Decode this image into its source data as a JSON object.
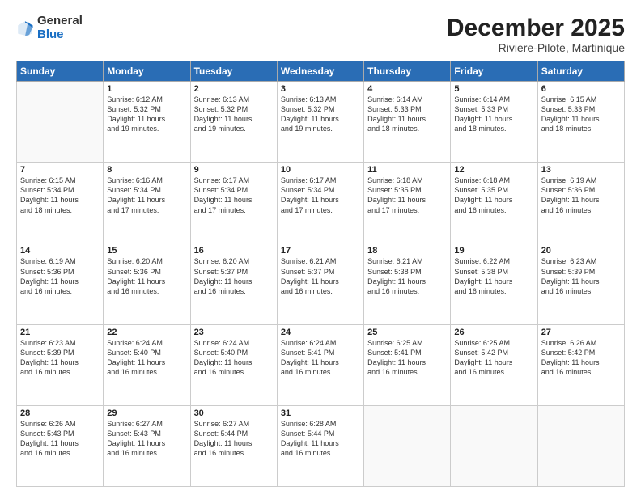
{
  "logo": {
    "general": "General",
    "blue": "Blue"
  },
  "title": "December 2025",
  "subtitle": "Riviere-Pilote, Martinique",
  "days_header": [
    "Sunday",
    "Monday",
    "Tuesday",
    "Wednesday",
    "Thursday",
    "Friday",
    "Saturday"
  ],
  "weeks": [
    [
      {
        "day": "",
        "info": ""
      },
      {
        "day": "1",
        "info": "Sunrise: 6:12 AM\nSunset: 5:32 PM\nDaylight: 11 hours\nand 19 minutes."
      },
      {
        "day": "2",
        "info": "Sunrise: 6:13 AM\nSunset: 5:32 PM\nDaylight: 11 hours\nand 19 minutes."
      },
      {
        "day": "3",
        "info": "Sunrise: 6:13 AM\nSunset: 5:32 PM\nDaylight: 11 hours\nand 19 minutes."
      },
      {
        "day": "4",
        "info": "Sunrise: 6:14 AM\nSunset: 5:33 PM\nDaylight: 11 hours\nand 18 minutes."
      },
      {
        "day": "5",
        "info": "Sunrise: 6:14 AM\nSunset: 5:33 PM\nDaylight: 11 hours\nand 18 minutes."
      },
      {
        "day": "6",
        "info": "Sunrise: 6:15 AM\nSunset: 5:33 PM\nDaylight: 11 hours\nand 18 minutes."
      }
    ],
    [
      {
        "day": "7",
        "info": "Sunrise: 6:15 AM\nSunset: 5:34 PM\nDaylight: 11 hours\nand 18 minutes."
      },
      {
        "day": "8",
        "info": "Sunrise: 6:16 AM\nSunset: 5:34 PM\nDaylight: 11 hours\nand 17 minutes."
      },
      {
        "day": "9",
        "info": "Sunrise: 6:17 AM\nSunset: 5:34 PM\nDaylight: 11 hours\nand 17 minutes."
      },
      {
        "day": "10",
        "info": "Sunrise: 6:17 AM\nSunset: 5:34 PM\nDaylight: 11 hours\nand 17 minutes."
      },
      {
        "day": "11",
        "info": "Sunrise: 6:18 AM\nSunset: 5:35 PM\nDaylight: 11 hours\nand 17 minutes."
      },
      {
        "day": "12",
        "info": "Sunrise: 6:18 AM\nSunset: 5:35 PM\nDaylight: 11 hours\nand 16 minutes."
      },
      {
        "day": "13",
        "info": "Sunrise: 6:19 AM\nSunset: 5:36 PM\nDaylight: 11 hours\nand 16 minutes."
      }
    ],
    [
      {
        "day": "14",
        "info": "Sunrise: 6:19 AM\nSunset: 5:36 PM\nDaylight: 11 hours\nand 16 minutes."
      },
      {
        "day": "15",
        "info": "Sunrise: 6:20 AM\nSunset: 5:36 PM\nDaylight: 11 hours\nand 16 minutes."
      },
      {
        "day": "16",
        "info": "Sunrise: 6:20 AM\nSunset: 5:37 PM\nDaylight: 11 hours\nand 16 minutes."
      },
      {
        "day": "17",
        "info": "Sunrise: 6:21 AM\nSunset: 5:37 PM\nDaylight: 11 hours\nand 16 minutes."
      },
      {
        "day": "18",
        "info": "Sunrise: 6:21 AM\nSunset: 5:38 PM\nDaylight: 11 hours\nand 16 minutes."
      },
      {
        "day": "19",
        "info": "Sunrise: 6:22 AM\nSunset: 5:38 PM\nDaylight: 11 hours\nand 16 minutes."
      },
      {
        "day": "20",
        "info": "Sunrise: 6:23 AM\nSunset: 5:39 PM\nDaylight: 11 hours\nand 16 minutes."
      }
    ],
    [
      {
        "day": "21",
        "info": "Sunrise: 6:23 AM\nSunset: 5:39 PM\nDaylight: 11 hours\nand 16 minutes."
      },
      {
        "day": "22",
        "info": "Sunrise: 6:24 AM\nSunset: 5:40 PM\nDaylight: 11 hours\nand 16 minutes."
      },
      {
        "day": "23",
        "info": "Sunrise: 6:24 AM\nSunset: 5:40 PM\nDaylight: 11 hours\nand 16 minutes."
      },
      {
        "day": "24",
        "info": "Sunrise: 6:24 AM\nSunset: 5:41 PM\nDaylight: 11 hours\nand 16 minutes."
      },
      {
        "day": "25",
        "info": "Sunrise: 6:25 AM\nSunset: 5:41 PM\nDaylight: 11 hours\nand 16 minutes."
      },
      {
        "day": "26",
        "info": "Sunrise: 6:25 AM\nSunset: 5:42 PM\nDaylight: 11 hours\nand 16 minutes."
      },
      {
        "day": "27",
        "info": "Sunrise: 6:26 AM\nSunset: 5:42 PM\nDaylight: 11 hours\nand 16 minutes."
      }
    ],
    [
      {
        "day": "28",
        "info": "Sunrise: 6:26 AM\nSunset: 5:43 PM\nDaylight: 11 hours\nand 16 minutes."
      },
      {
        "day": "29",
        "info": "Sunrise: 6:27 AM\nSunset: 5:43 PM\nDaylight: 11 hours\nand 16 minutes."
      },
      {
        "day": "30",
        "info": "Sunrise: 6:27 AM\nSunset: 5:44 PM\nDaylight: 11 hours\nand 16 minutes."
      },
      {
        "day": "31",
        "info": "Sunrise: 6:28 AM\nSunset: 5:44 PM\nDaylight: 11 hours\nand 16 minutes."
      },
      {
        "day": "",
        "info": ""
      },
      {
        "day": "",
        "info": ""
      },
      {
        "day": "",
        "info": ""
      }
    ]
  ]
}
